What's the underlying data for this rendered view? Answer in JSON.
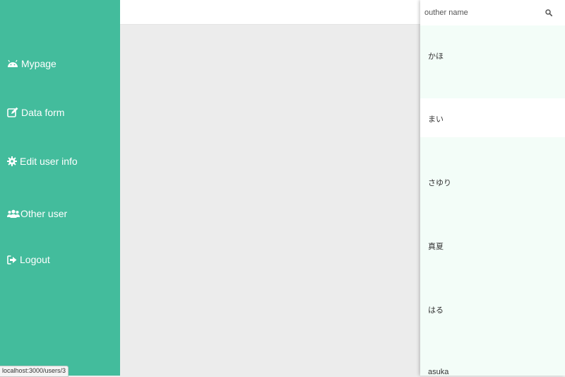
{
  "sidebar": {
    "items": [
      {
        "label": "Mypage",
        "icon": "android-icon"
      },
      {
        "label": "Data form",
        "icon": "edit-icon"
      },
      {
        "label": "Edit user info",
        "icon": "gear-icon"
      },
      {
        "label": "Other user",
        "icon": "users-icon"
      },
      {
        "label": "Logout",
        "icon": "sign-out-icon"
      }
    ]
  },
  "search": {
    "placeholder": "outher name",
    "icon": "search-icon"
  },
  "users": [
    {
      "name": "かほ"
    },
    {
      "name": "まい"
    },
    {
      "name": "さゆり"
    },
    {
      "name": "真夏"
    },
    {
      "name": "はる"
    },
    {
      "name": "asuka"
    }
  ],
  "status_bar": {
    "url": "localhost:3000/users/3"
  },
  "colors": {
    "sidebar_bg": "#43bc9c",
    "panel_bg": "#f3fdf8",
    "highlight_row_bg": "#ffffff",
    "main_bg": "#ececec"
  }
}
